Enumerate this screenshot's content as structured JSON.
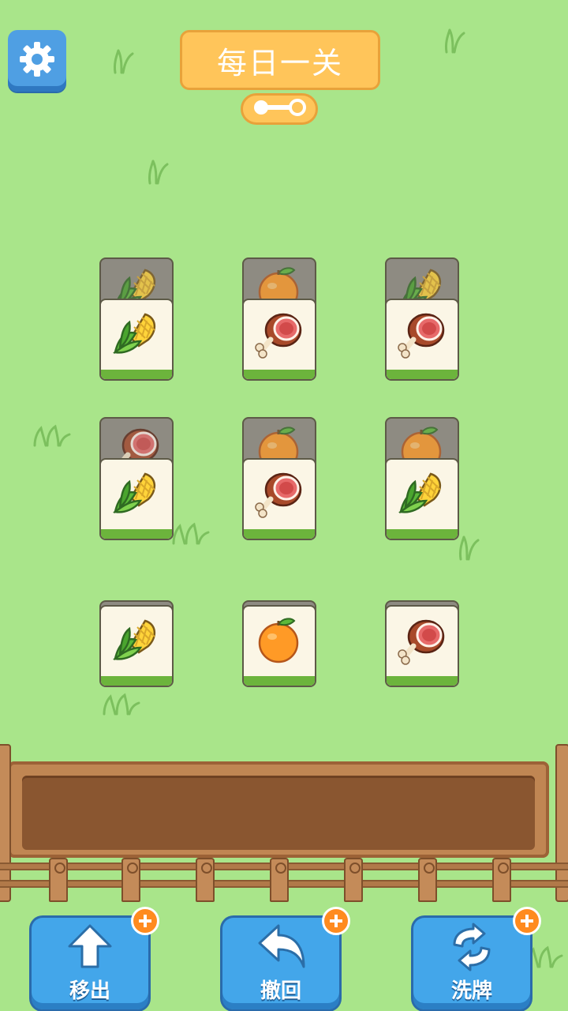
{
  "header": {
    "title": "每日一关",
    "settings_icon": "gear-icon",
    "progress_icon": "level-progress-icon"
  },
  "board": {
    "rows": [
      {
        "cells": [
          {
            "top": "corn",
            "back": "corn"
          },
          {
            "top": "ham",
            "back": "orange"
          },
          {
            "top": "ham",
            "back": "corn"
          }
        ]
      },
      {
        "cells": [
          {
            "top": "corn",
            "back": "ham"
          },
          {
            "top": "ham",
            "back": "orange"
          },
          {
            "top": "corn",
            "back": "orange"
          }
        ]
      },
      {
        "cells": [
          {
            "top": "corn"
          },
          {
            "top": "orange"
          },
          {
            "top": "ham"
          }
        ]
      }
    ]
  },
  "tray": {
    "slots_filled": 0
  },
  "toolbar": {
    "move_out_label": "移出",
    "undo_label": "撤回",
    "shuffle_label": "洗牌"
  },
  "colors": {
    "background": "#a9e58a",
    "button_blue": "#43a6ea",
    "title_orange": "#ffc55a",
    "plus_orange": "#ff8b1f"
  }
}
